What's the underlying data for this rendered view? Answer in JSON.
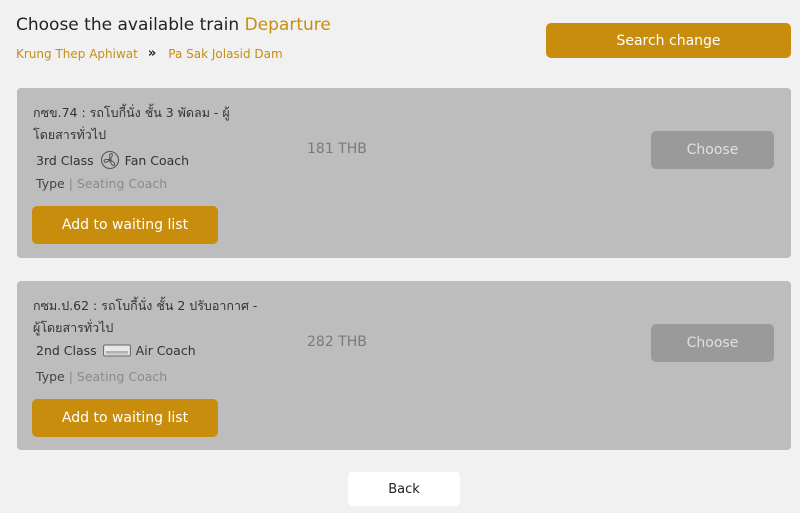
{
  "header": {
    "title_prefix": "Choose the available train",
    "title_accent": "Departure",
    "route_from": "Krung Thep Aphiwat",
    "route_separator": "»",
    "route_to": "Pa Sak Jolasid Dam",
    "search_change_label": "Search change"
  },
  "colors": {
    "accent": "#c98d0e",
    "card_bg": "#bdbdbd",
    "disabled_button": "#9a9a9a",
    "page_bg": "#f1f1f1"
  },
  "trains": [
    {
      "name": "กซข.74 : รถโบกี้นั่ง ชั้น 3 พัดลม - ผู้โดยสารทั่วไป",
      "class_label": "3rd Class",
      "class_icon": "fan-icon",
      "coach_label": "Fan Coach",
      "type_label": "Type",
      "type_separator": "|",
      "type_value": "Seating Coach",
      "price": "181 THB",
      "choose_label": "Choose",
      "waiting_label": "Add to waiting list"
    },
    {
      "name": "กซม.ป.62 : รถโบกี้นั่ง ชั้น 2 ปรับอากาศ - ผู้โดยสารทั่วไป",
      "class_label": "2nd Class",
      "class_icon": "air-conditioner-icon",
      "coach_label": "Air Coach",
      "type_label": "Type",
      "type_separator": "|",
      "type_value": "Seating Coach",
      "price": "282 THB",
      "choose_label": "Choose",
      "waiting_label": "Add to waiting list"
    }
  ],
  "footer": {
    "back_label": "Back"
  }
}
